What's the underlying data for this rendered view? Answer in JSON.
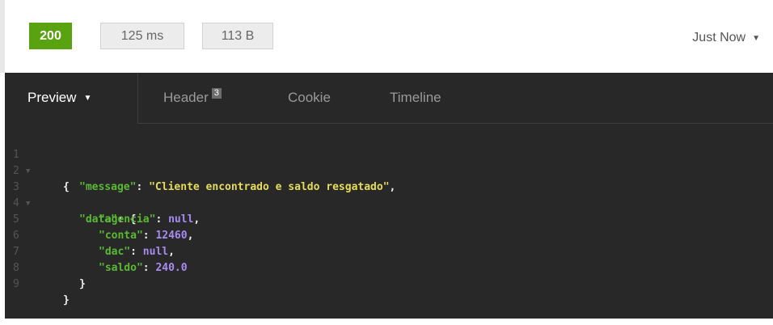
{
  "response": {
    "status": "200",
    "time": "125 ms",
    "size": "113 B",
    "history": "Just Now"
  },
  "tabs": {
    "preview": "Preview",
    "header": "Header",
    "header_count": "3",
    "cookie": "Cookie",
    "timeline": "Timeline"
  },
  "colors": {
    "status_ok": "#59a210",
    "key": "#5ab932",
    "string": "#e6dc5a",
    "number": "#a88bf0",
    "background": "#282828"
  },
  "code": {
    "line_numbers": [
      "1",
      "2",
      "3",
      "4",
      "5",
      "6",
      "7",
      "8",
      "9"
    ],
    "l1_open": "{",
    "l2_key": "\"message\"",
    "l2_sep": ": ",
    "l2_val": "\"Cliente encontrado e saldo resgatado\"",
    "l2_end": ",",
    "l3_key": "\"data\"",
    "l3_sep": ": {",
    "l4_key": "\"agencia\"",
    "l4_sep": ": ",
    "l4_val": "null",
    "l4_end": ",",
    "l5_key": "\"conta\"",
    "l5_sep": ": ",
    "l5_val": "12460",
    "l5_end": ",",
    "l6_key": "\"dac\"",
    "l6_sep": ": ",
    "l6_val": "null",
    "l6_end": ",",
    "l7_key": "\"saldo\"",
    "l7_sep": ": ",
    "l7_val": "240.0",
    "l8_close": "}",
    "l9_close": "}"
  }
}
